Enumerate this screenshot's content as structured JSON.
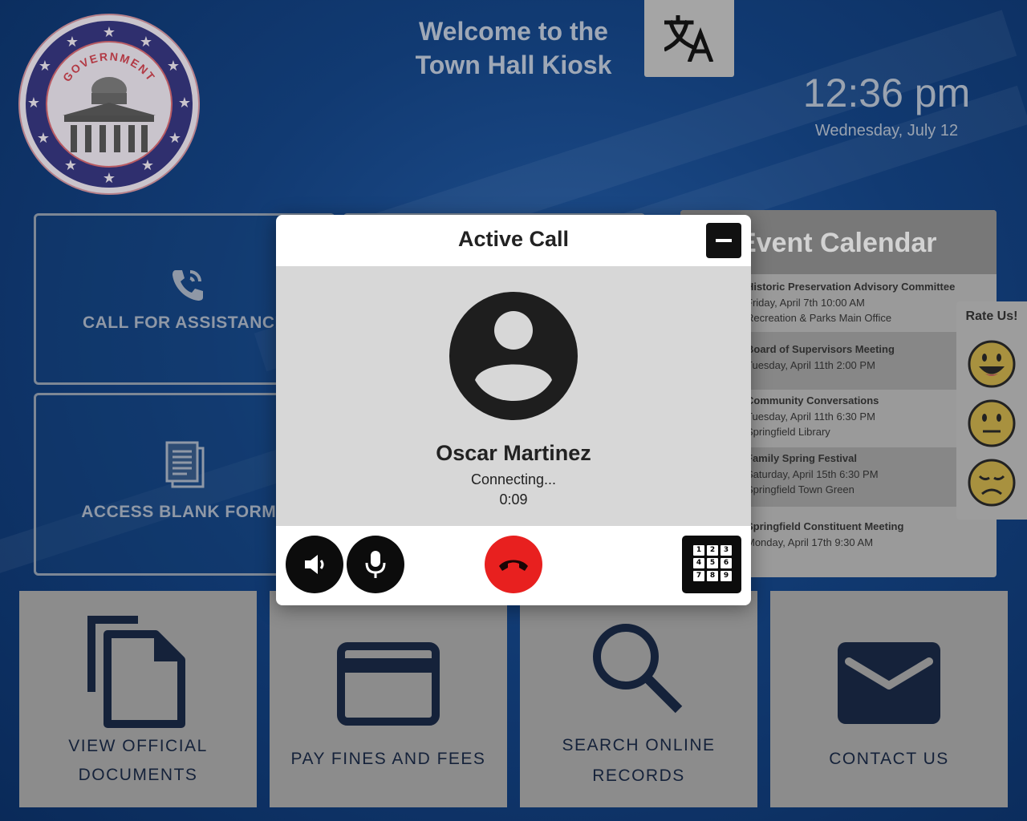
{
  "header": {
    "welcome_line1": "Welcome to the",
    "welcome_line2": "Town Hall Kiosk",
    "seal_text": "GOVERNMENT",
    "translate_icon": "translate-icon"
  },
  "clock": {
    "time": "12:36 pm",
    "date": "Wednesday, July 12"
  },
  "side_tiles": [
    {
      "label": "CALL FOR ASSISTANCE",
      "icon": "phone-call-icon"
    },
    {
      "label": "ACCESS BLANK FORMS",
      "icon": "document-icon"
    }
  ],
  "calendar": {
    "title": "Event Calendar",
    "events": [
      {
        "title": "Historic Preservation Advisory Committee",
        "when": "Friday, April 7th 10:00 AM",
        "where": "Recreation & Parks Main Office"
      },
      {
        "title": "Board of Supervisors Meeting",
        "when": "Tuesday, April 11th 2:00 PM",
        "where": ""
      },
      {
        "title": "Community Conversations",
        "when": "Tuesday, April 11th 6:30 PM",
        "where": "Springfield Library"
      },
      {
        "title": "Family Spring Festival",
        "when": "Saturday, April 15th 6:30 PM",
        "where": "Springfield Town Green"
      },
      {
        "title": "Springfield Constituent Meeting",
        "when": "Monday, April 17th 9:30 AM",
        "where": ""
      }
    ]
  },
  "rate": {
    "title": "Rate Us!",
    "faces": [
      "happy-face-icon",
      "neutral-face-icon",
      "sad-face-icon"
    ]
  },
  "bottom_tiles": [
    {
      "line1": "VIEW OFFICIAL",
      "line2": "DOCUMENTS",
      "icon": "documents-icon"
    },
    {
      "line1": "PAY FINES AND FEES",
      "line2": "",
      "icon": "credit-card-icon"
    },
    {
      "line1": "SEARCH ONLINE",
      "line2": "RECORDS",
      "icon": "search-icon"
    },
    {
      "line1": "CONTACT US",
      "line2": "",
      "icon": "mail-icon"
    }
  ],
  "call_modal": {
    "title": "Active Call",
    "caller_name": "Oscar Martinez",
    "status": "Connecting...",
    "duration": "0:09",
    "keypad_keys": [
      "1",
      "2",
      "3",
      "4",
      "5",
      "6",
      "7",
      "8",
      "9"
    ],
    "colors": {
      "end_call": "#e8201f",
      "controls": "#0c0c0c"
    }
  }
}
